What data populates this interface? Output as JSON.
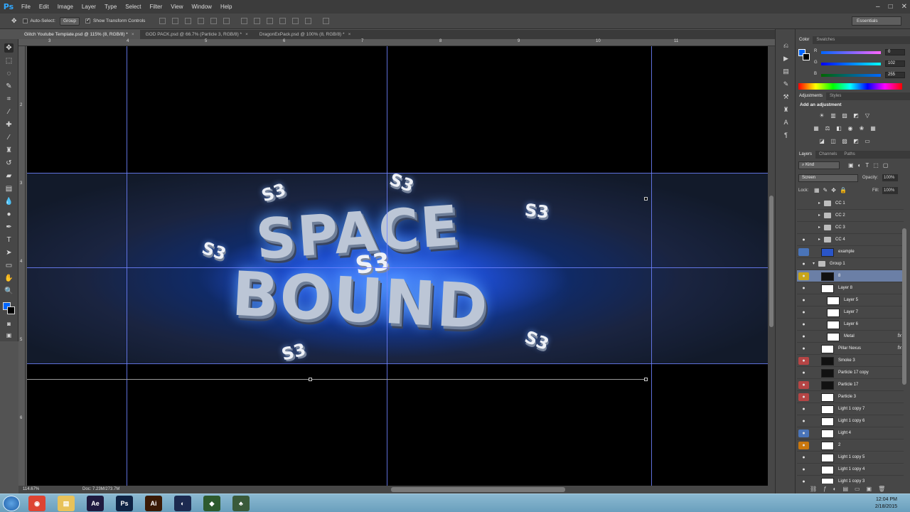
{
  "app": {
    "logo": "Ps"
  },
  "menu": [
    "File",
    "Edit",
    "Image",
    "Layer",
    "Type",
    "Select",
    "Filter",
    "View",
    "Window",
    "Help"
  ],
  "window_controls": [
    "–",
    "□",
    "✕"
  ],
  "options": {
    "auto_select_label": "Auto-Select:",
    "auto_select_value": "Group",
    "show_transform_label": "Show Transform Controls",
    "workspace": "Essentials"
  },
  "tabs": [
    {
      "label": "Glitch Youtube Template.psd @ 115% (8, RGB/8) *",
      "close": "×"
    },
    {
      "label": "GOD PACK.psd @ 66.7% (Particle 3, RGB/8) *",
      "close": "×"
    },
    {
      "label": "DragonExPack.psd @ 100% (8, RGB/8) *",
      "close": "×"
    }
  ],
  "ruler": {
    "top": [
      "3",
      "4",
      "5",
      "6",
      "7",
      "8",
      "9",
      "10",
      "11"
    ],
    "left": [
      "2",
      "3",
      "4",
      "5",
      "6"
    ]
  },
  "canvas": {
    "title_line1": "SPACE",
    "title_line2": "BOUND",
    "badge": "S3"
  },
  "status": {
    "zoom": "114.67%",
    "doc": "Doc: 7.23M/273.7M"
  },
  "color_panel": {
    "tabs": [
      "Color",
      "Swatches"
    ],
    "r_label": "R",
    "g_label": "G",
    "b_label": "B",
    "r": "0",
    "g": "102",
    "b": "255",
    "fg_color": "#0066ff"
  },
  "adjustments": {
    "tabs": [
      "Adjustments",
      "Styles"
    ],
    "heading": "Add an adjustment"
  },
  "layers_panel": {
    "tabs": [
      "Layers",
      "Channels",
      "Paths"
    ],
    "filter_kind": "Kind",
    "blend_mode": "Screen",
    "opacity_label": "Opacity:",
    "opacity": "100%",
    "lock_label": "Lock:",
    "fill_label": "Fill:",
    "fill": "100%",
    "layers": [
      {
        "name": "CC 1",
        "kind": "folder",
        "eye": "",
        "indent": 1
      },
      {
        "name": "CC 2",
        "kind": "folder",
        "eye": "",
        "indent": 1
      },
      {
        "name": "CC 3",
        "kind": "folder",
        "eye": "",
        "indent": 1
      },
      {
        "name": "CC 4",
        "kind": "folder",
        "eye": "●",
        "indent": 1
      },
      {
        "name": "example",
        "kind": "thumb-blue",
        "eye": "",
        "indent": 1,
        "eye_color": "blue"
      },
      {
        "name": "Group 1",
        "kind": "group",
        "eye": "●",
        "indent": 0
      },
      {
        "name": "8",
        "kind": "thumb-dark",
        "eye": "●",
        "indent": 1,
        "eye_color": "yellow",
        "selected": true
      },
      {
        "name": "Layer 8",
        "kind": "thumb",
        "eye": "●",
        "indent": 1
      },
      {
        "name": "Layer 5",
        "kind": "thumb",
        "eye": "●",
        "indent": 2
      },
      {
        "name": "Layer 7",
        "kind": "thumb",
        "eye": "●",
        "indent": 2
      },
      {
        "name": "Layer 6",
        "kind": "thumb",
        "eye": "●",
        "indent": 2
      },
      {
        "name": "Metal",
        "kind": "thumb",
        "eye": "●",
        "indent": 2,
        "fx": "fx"
      },
      {
        "name": "Pillar Nexus",
        "kind": "thumb",
        "eye": "●",
        "indent": 1,
        "fx": "fx"
      },
      {
        "name": "Smoke 3",
        "kind": "thumb-dark",
        "eye": "●",
        "indent": 1,
        "eye_color": "red"
      },
      {
        "name": "Particle 17 copy",
        "kind": "thumb-dark",
        "eye": "●",
        "indent": 1
      },
      {
        "name": "Particle 17",
        "kind": "thumb-dark",
        "eye": "●",
        "indent": 1,
        "eye_color": "red"
      },
      {
        "name": "Particle 3",
        "kind": "thumb",
        "eye": "●",
        "indent": 1,
        "eye_color": "red"
      },
      {
        "name": "Light 1 copy 7",
        "kind": "thumb",
        "eye": "●",
        "indent": 1
      },
      {
        "name": "Light 1 copy 6",
        "kind": "thumb",
        "eye": "●",
        "indent": 1
      },
      {
        "name": "Light 4",
        "kind": "thumb",
        "eye": "●",
        "indent": 1,
        "eye_color": "blue"
      },
      {
        "name": "2",
        "kind": "thumb",
        "eye": "●",
        "indent": 1,
        "eye_color": "orange"
      },
      {
        "name": "Light 1 copy 5",
        "kind": "thumb",
        "eye": "●",
        "indent": 1
      },
      {
        "name": "Light 1 copy 4",
        "kind": "thumb",
        "eye": "●",
        "indent": 1
      },
      {
        "name": "Light 1 copy 3",
        "kind": "thumb",
        "eye": "●",
        "indent": 1
      }
    ]
  },
  "taskbar": {
    "apps": [
      {
        "label": "◉",
        "color": "#dd4433"
      },
      {
        "label": "▤",
        "color": "#e8c25a"
      },
      {
        "label": "Ae",
        "color": "#1f1a40"
      },
      {
        "label": "Ps",
        "color": "#0f2344"
      },
      {
        "label": "Ai",
        "color": "#3a1a05"
      },
      {
        "label": "◐",
        "color": "#1c2a50"
      },
      {
        "label": "◆",
        "color": "#2d5a2d"
      },
      {
        "label": "♣",
        "color": "#3a5a3a"
      }
    ],
    "time": "12:04 PM",
    "date": "2/18/2015"
  }
}
